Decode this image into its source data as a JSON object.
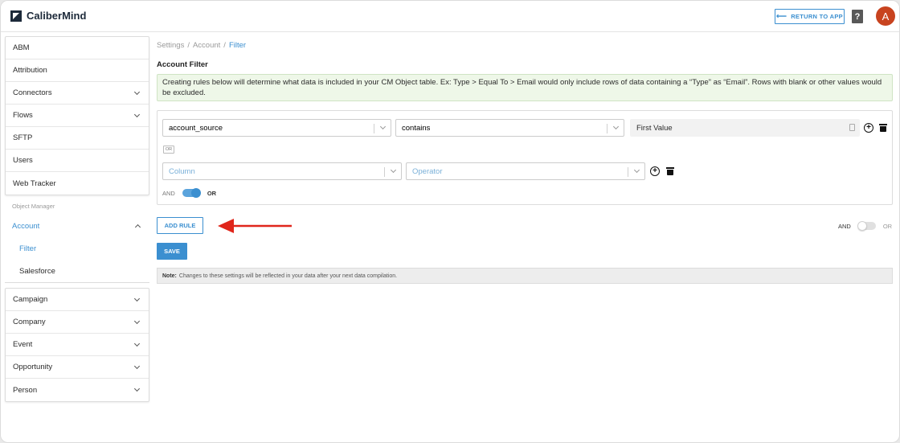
{
  "header": {
    "app_name": "CaliberMind",
    "return_label": "RETURN TO APP",
    "help_glyph": "?",
    "avatar_initial": "A"
  },
  "sidebar": {
    "group1": [
      "ABM",
      "Attribution",
      "Connectors",
      "Flows",
      "SFTP",
      "Users",
      "Web Tracker"
    ],
    "section_label": "Object Manager",
    "account": "Account",
    "account_children": [
      "Filter",
      "Salesforce"
    ],
    "group2": [
      "Campaign",
      "Company",
      "Event",
      "Opportunity",
      "Person"
    ]
  },
  "breadcrumb": [
    "Settings",
    "Account",
    "Filter"
  ],
  "page_title": "Account Filter",
  "info_text": "Creating rules below will determine what data is included in your CM Object table. Ex: Type > Equal To > Email would only include rows of data containing a “Type” as “Email”. Rows with blank or other values would be excluded.",
  "rules": {
    "rule1": {
      "column": "account_source",
      "operator": "contains",
      "value": "First Value"
    },
    "or_chip": "OR",
    "rule2": {
      "column_placeholder": "Column",
      "operator_placeholder": "Operator"
    },
    "inner_toggle": {
      "left": "AND",
      "right": "OR",
      "state": "OR"
    }
  },
  "add_rule_label": "ADD RULE",
  "outer_toggle": {
    "left": "AND",
    "right": "OR",
    "state": "AND"
  },
  "save_label": "SAVE",
  "note": {
    "label": "Note:",
    "text": "Changes to these settings will be reflected in your data after your next data compilation."
  },
  "colors": {
    "accent": "#3b8fd0",
    "annotation_arrow": "#e0261b",
    "info_bg": "#eef7e8"
  }
}
